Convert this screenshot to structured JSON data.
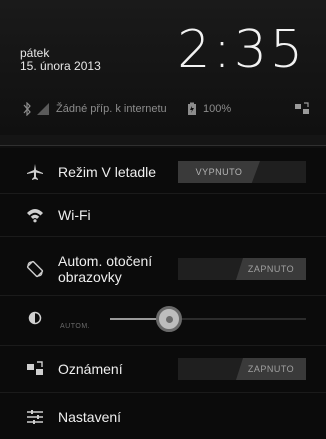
{
  "header": {
    "day": "pátek",
    "date": "15. února 2013",
    "time": "2:35",
    "network_text": "Žádné příp. k internetu",
    "battery": "100%"
  },
  "quick_settings": {
    "airplane": {
      "label": "Režim V letadle",
      "state": "VYPNUTO"
    },
    "wifi": {
      "label": "Wi-Fi"
    },
    "rotation": {
      "label_line1": "Autom. otočení",
      "label_line2": "obrazovky",
      "state": "ZAPNUTO"
    },
    "brightness": {
      "auto_label": "AUTOM.",
      "level": 0.3
    },
    "notifications": {
      "label": "Oznámení",
      "state": "ZAPNUTO"
    },
    "settings": {
      "label": "Nastavení"
    }
  },
  "colors": {
    "background": "#0b0b0b",
    "toggle": "#3a3a3a",
    "text": "#efefef"
  },
  "icons": [
    "bluetooth-icon",
    "signal-icon",
    "battery-icon",
    "notifications-icon",
    "airplane-icon",
    "wifi-icon",
    "rotation-icon",
    "brightness-icon",
    "settings-sliders-icon"
  ]
}
